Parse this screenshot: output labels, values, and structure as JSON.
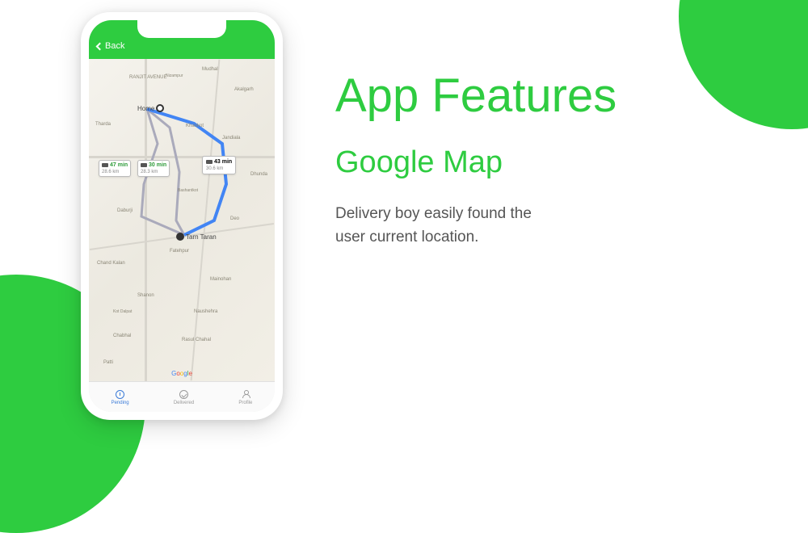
{
  "marketing": {
    "title": "App Features",
    "subtitle": "Google Map",
    "description": "Delivery boy easily found the user current location."
  },
  "app": {
    "header": {
      "back_label": "Back"
    },
    "map": {
      "origin_label": "Home",
      "destination_label": "Tarn Taran",
      "routes": [
        {
          "time": "47 min",
          "distance": "28.6 km"
        },
        {
          "time": "30 min",
          "distance": "28.3 km"
        },
        {
          "time": "43 min",
          "distance": "30.6 km"
        }
      ],
      "places": [
        "RANJIT AVENUE",
        "Mudhal",
        "Nizampur",
        "Khankot",
        "Jandiala",
        "Tharda",
        "Dhunda",
        "Daburji",
        "Kot Dalpat",
        "Fatehpur",
        "Mainohan",
        "Shanon",
        "Naushehra",
        "Rasul Chahal",
        "Chabhal",
        "Patti",
        "Akalgarh",
        "Chand Kalan",
        "Bashantkot",
        "Deo"
      ],
      "attribution": "Google"
    },
    "tabs": [
      {
        "label": "Pending"
      },
      {
        "label": "Delivered"
      },
      {
        "label": "Profile"
      }
    ]
  }
}
